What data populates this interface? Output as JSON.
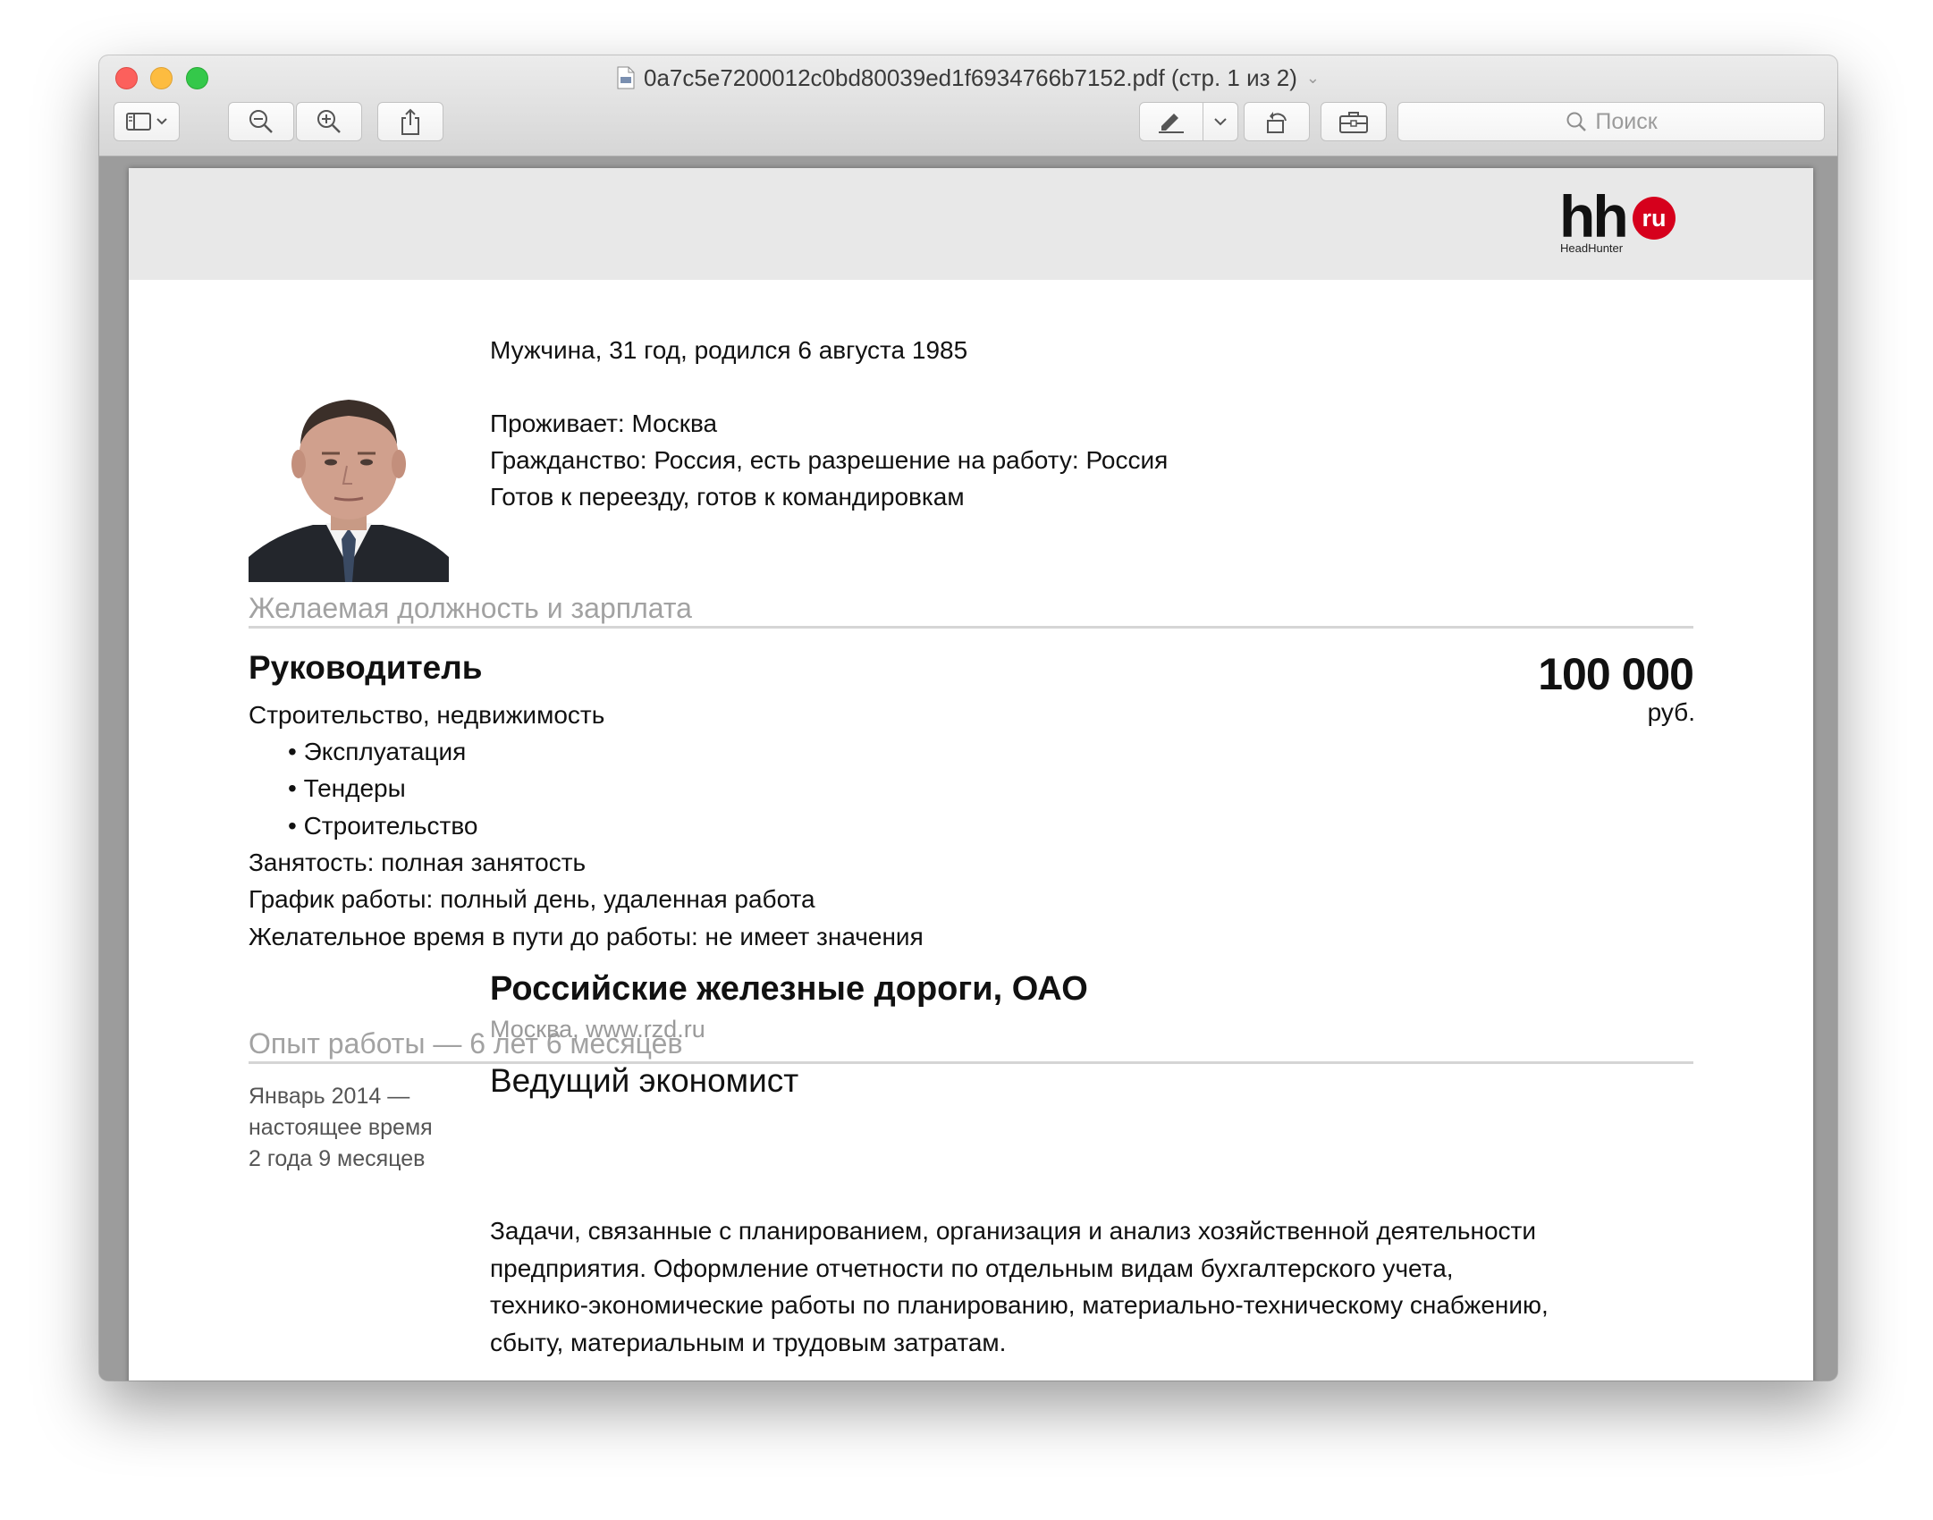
{
  "window": {
    "title": "0a7c5e7200012c0bd80039ed1f6934766b7152.pdf (стр. 1 из 2)"
  },
  "toolbar": {
    "search_placeholder": "Поиск"
  },
  "logo": {
    "brand": "hh",
    "badge": "ru",
    "subtitle": "HeadHunter"
  },
  "personal": {
    "line1": "Мужчина, 31 год, родился 6 августа 1985",
    "residence": "Проживает: Москва",
    "citizenship": "Гражданство: Россия, есть разрешение на работу: Россия",
    "relocation": "Готов к переезду, готов к командировкам"
  },
  "desired": {
    "section_title": "Желаемая должность и зарплата",
    "position": "Руководитель",
    "salary": "100 000",
    "currency": "руб.",
    "field": "Строительство, недвижимость",
    "specializations": [
      "• Эксплуатация",
      "• Тендеры",
      "• Строительство"
    ],
    "employment": "Занятость: полная занятость",
    "schedule": "График работы: полный день, удаленная работа",
    "commute": "Желательное время в пути до работы: не имеет значения"
  },
  "experience": {
    "section_title": "Опыт работы — 6 лет 6 месяцев",
    "jobs": [
      {
        "date_from": "Январь 2014 —",
        "date_to": "настоящее время",
        "duration": "2 года 9 месяцев",
        "company": "Российские железные дороги, ОАО",
        "location": "Москва, www.rzd.ru",
        "position": "Ведущий экономист",
        "description_lines": [
          "Задачи, связанные с планированием, организация и анализ хозяйственной деятельности",
          "предприятия. Оформление отчетности по отдельным видам бухгалтерского учета,",
          "технико-экономические работы по планированию, материально-техническому снабжению,",
          "сбыту, материальным и трудовым затратам."
        ]
      }
    ]
  },
  "colors": {
    "logo_red": "#d6001c",
    "section_gray": "#a2a2a2",
    "header_gray": "#e8e8e8"
  }
}
